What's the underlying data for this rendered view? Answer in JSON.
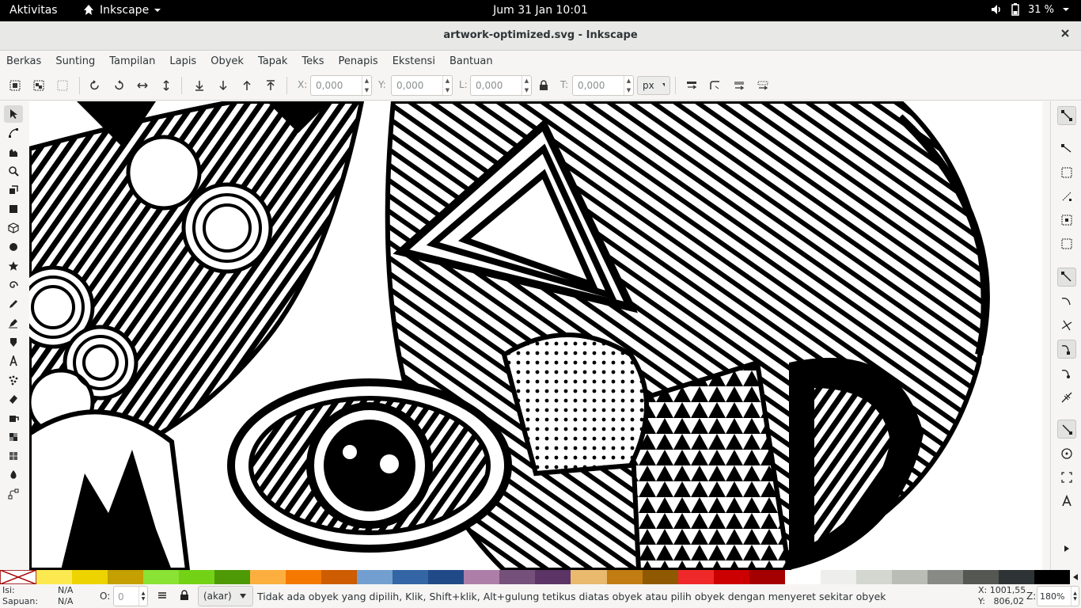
{
  "topbar": {
    "activities": "Aktivitas",
    "app_name": "Inkscape",
    "clock": "Jum 31 Jan  10:01",
    "battery": "31 %"
  },
  "window": {
    "title": "artwork-optimized.svg - Inkscape"
  },
  "menu": [
    "Berkas",
    "Sunting",
    "Tampilan",
    "Lapis",
    "Obyek",
    "Tapak",
    "Teks",
    "Penapis",
    "Ekstensi",
    "Bantuan"
  ],
  "select_toolbar": {
    "x_label": "X:",
    "x_value": "0,000",
    "y_label": "Y:",
    "y_value": "0,000",
    "w_label": "L:",
    "w_value": "0,000",
    "h_label": "T:",
    "h_value": "0,000",
    "unit": "px"
  },
  "palette": [
    "#fce94f",
    "#edd400",
    "#c4a000",
    "#8ae234",
    "#73d216",
    "#4e9a06",
    "#fcaf3e",
    "#f57900",
    "#ce5c00",
    "#729fcf",
    "#3465a4",
    "#204a87",
    "#ad7fa8",
    "#75507b",
    "#5c3566",
    "#e9b96e",
    "#c17d11",
    "#8f5902",
    "#ef2929",
    "#cc0000",
    "#a40000",
    "#ffffff",
    "#eeeeec",
    "#d3d7cf",
    "#babdb6",
    "#888a85",
    "#555753",
    "#2e3436",
    "#000000"
  ],
  "statusbar": {
    "fill_label": "Isi:",
    "fill_value": "N/A",
    "stroke_label": "Sapuan:",
    "stroke_value": "N/A",
    "opacity_label": "O:",
    "opacity_value": "0",
    "layer": "(akar)",
    "message": "Tidak ada obyek yang dipilih, Klik, Shift+klik, Alt+gulung tetikus diatas obyek atau pilih obyek dengan menyeret sekitar obyek",
    "cursor_x": "X: 1001,55",
    "cursor_y": "Y:   806,02",
    "zoom_label": "Z:",
    "zoom_value": "180%"
  }
}
